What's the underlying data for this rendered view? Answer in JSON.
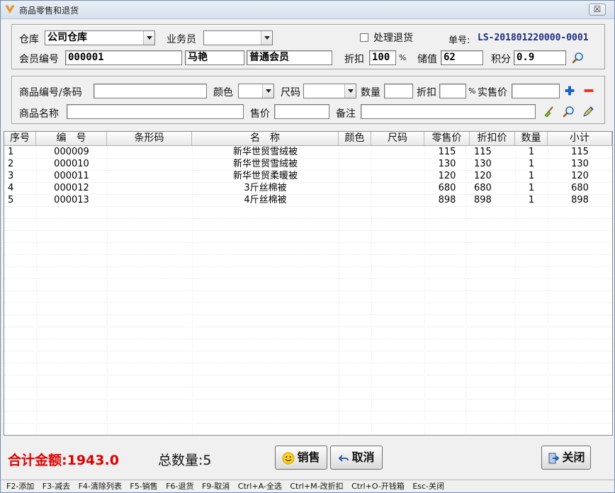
{
  "window": {
    "title": "商品零售和退货",
    "close_glyph": "☒"
  },
  "header": {
    "warehouse_label": "仓库",
    "warehouse_value": "公司仓库",
    "salesperson_label": "业务员",
    "salesperson_value": "",
    "return_checkbox_label": "处理退货",
    "return_checked": false,
    "order_no_label": "单号:",
    "order_no_value": "LS-201801220000-0001",
    "member_no_label": "会员编号",
    "member_no_value": "000001",
    "member_name_value": "马艳",
    "member_level_value": "普通会员",
    "discount_label": "折扣",
    "discount_value": "100",
    "discount_unit": "%",
    "stored_value_label": "储值",
    "stored_value_value": "62",
    "points_label": "积分",
    "points_value": "0.9"
  },
  "entry": {
    "product_code_label": "商品编号/条码",
    "product_code_value": "",
    "color_label": "颜色",
    "color_value": "",
    "size_label": "尺码",
    "size_value": "",
    "quantity_label": "数量",
    "quantity_value": "",
    "discount_label": "折扣",
    "discount_value": "",
    "discount_unit": "%",
    "actual_price_label": "实售价",
    "actual_price_value": "",
    "product_name_label": "商品名称",
    "product_name_value": "",
    "price_label": "售价",
    "price_value": "",
    "remark_label": "备注",
    "remark_value": ""
  },
  "table": {
    "columns": [
      "序号",
      "编　号",
      "条形码",
      "名　称",
      "颜色",
      "尺码",
      "零售价",
      "折扣价",
      "数量",
      "小计"
    ],
    "rows": [
      [
        "1",
        "000009",
        "",
        "新华世贸雪绒被",
        "",
        "",
        "115",
        "115",
        "1",
        "115"
      ],
      [
        "2",
        "000010",
        "",
        "新华世贸雪绒被",
        "",
        "",
        "130",
        "130",
        "1",
        "130"
      ],
      [
        "3",
        "000011",
        "",
        "新华世贸柔暖被",
        "",
        "",
        "120",
        "120",
        "1",
        "120"
      ],
      [
        "4",
        "000012",
        "",
        "3斤丝棉被",
        "",
        "",
        "680",
        "680",
        "1",
        "680"
      ],
      [
        "5",
        "000013",
        "",
        "4斤丝棉被",
        "",
        "",
        "898",
        "898",
        "1",
        "898"
      ]
    ]
  },
  "footer": {
    "total_amount_label": "合计金额:",
    "total_amount_value": "1943.0",
    "total_qty_label": "总数量:",
    "total_qty_value": "5",
    "sell_button": "销售",
    "cancel_button": "取消",
    "close_button": "关闭"
  },
  "shortcuts": [
    "F2-添加",
    "F3-减去",
    "F4-清除列表",
    "F5-销售",
    "F6-退货",
    "F9-取消",
    "Ctrl+A-全选",
    "Ctrl+M-改折扣",
    "Ctrl+O-开钱箱",
    "Esc-关闭"
  ],
  "colors": {
    "total_red": "#e00000",
    "order_no_blue": "#1a2b80",
    "plus_blue": "#1a5fc8",
    "minus_red": "#e03a2a"
  }
}
